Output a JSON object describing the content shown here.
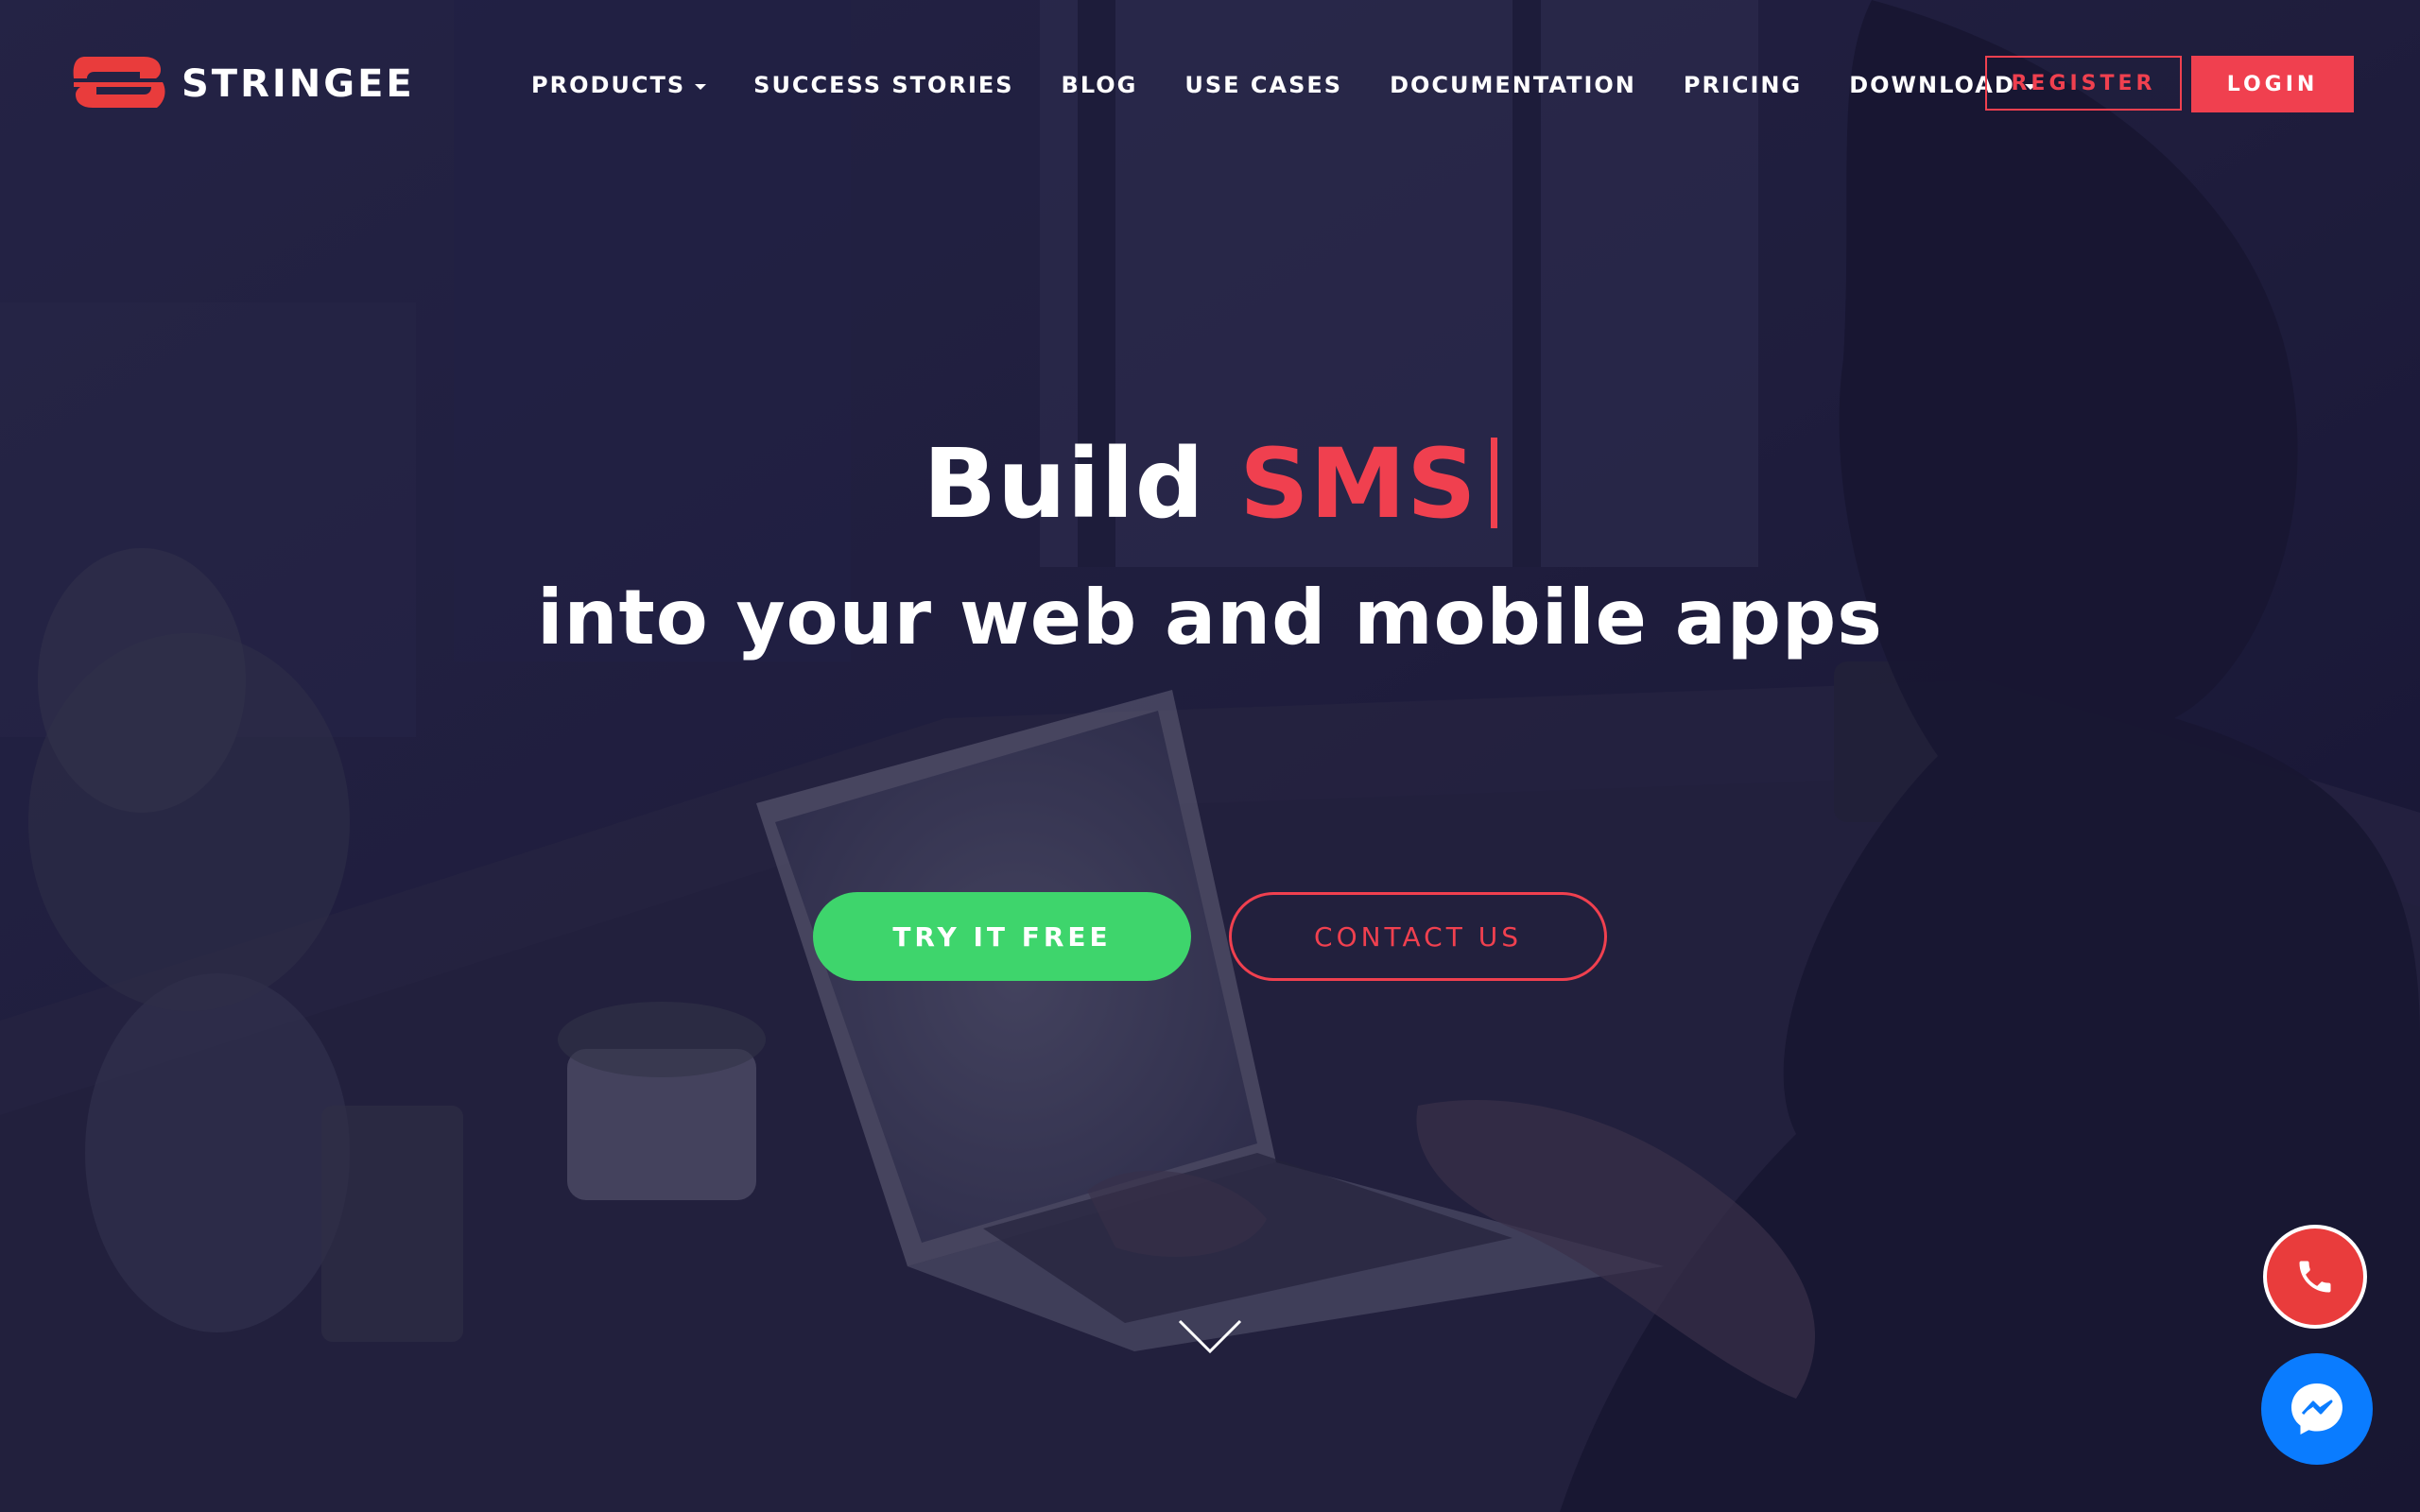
{
  "brand": {
    "name": "STRINGEE",
    "accent_color": "#f0404f",
    "cta_color": "#3ed56c",
    "messenger_color": "#0a7cff"
  },
  "nav": {
    "items": [
      {
        "label": "PRODUCTS",
        "dropdown": true
      },
      {
        "label": "SUCCESS STORIES",
        "dropdown": false
      },
      {
        "label": "BLOG",
        "dropdown": false
      },
      {
        "label": "USE CASES",
        "dropdown": false
      },
      {
        "label": "DOCUMENTATION",
        "dropdown": false
      },
      {
        "label": "PRICING",
        "dropdown": false
      },
      {
        "label": "DOWNLOAD",
        "dropdown": true
      }
    ],
    "register_label": "REGISTER",
    "login_label": "LOGIN"
  },
  "hero": {
    "headline_prefix": "Build",
    "headline_highlight": "SMS",
    "subheadline": "into your web and mobile apps",
    "try_label": "TRY IT FREE",
    "contact_label": "CONTACT US"
  },
  "floating": {
    "phone_icon": "phone-icon",
    "messenger_icon": "messenger-icon",
    "scroll_icon": "chevron-down-icon"
  }
}
